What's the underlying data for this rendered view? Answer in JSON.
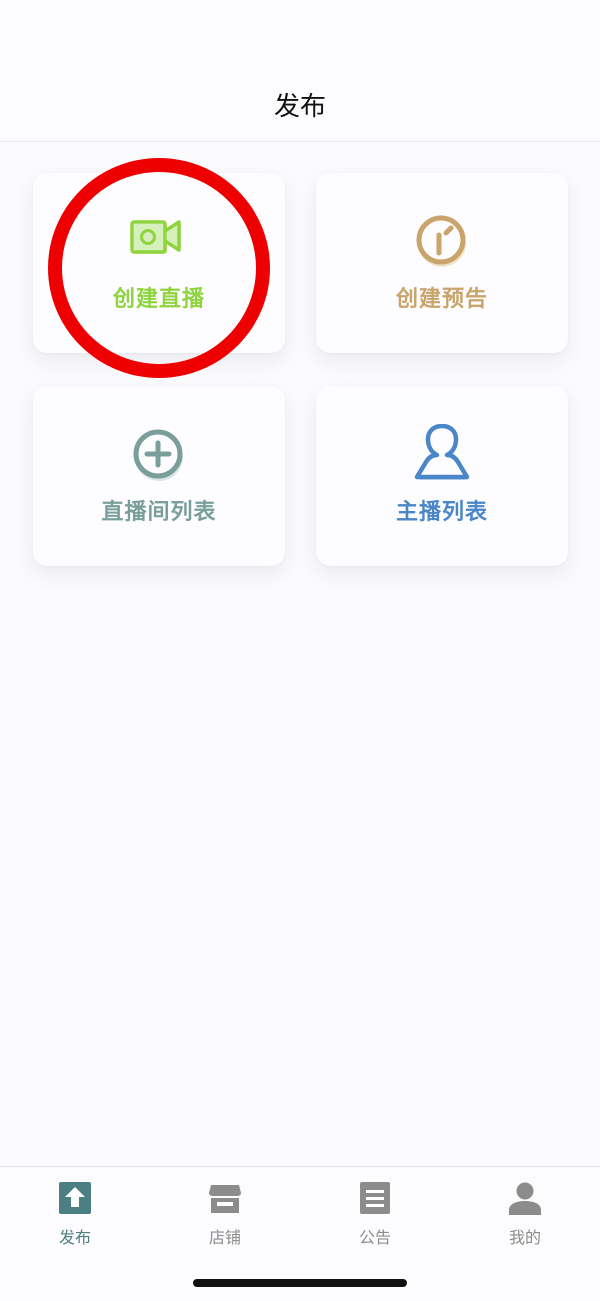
{
  "header": {
    "title": "发布"
  },
  "cards": [
    {
      "label": "创建直播",
      "icon": "video-camera-icon",
      "color": "#8fd43f"
    },
    {
      "label": "创建预告",
      "icon": "clock-icon",
      "color": "#c9a46b"
    },
    {
      "label": "直播间列表",
      "icon": "plus-circle-icon",
      "color": "#7a9f9a"
    },
    {
      "label": "主播列表",
      "icon": "user-icon",
      "color": "#4a86c8"
    }
  ],
  "highlight": {
    "color": "#ee0000"
  },
  "tabbar": {
    "active_color": "#4c7f84",
    "inactive_color": "#8c8c8c",
    "items": [
      {
        "label": "发布",
        "icon": "upload-icon"
      },
      {
        "label": "店铺",
        "icon": "store-icon"
      },
      {
        "label": "公告",
        "icon": "document-icon"
      },
      {
        "label": "我的",
        "icon": "person-icon"
      }
    ]
  }
}
